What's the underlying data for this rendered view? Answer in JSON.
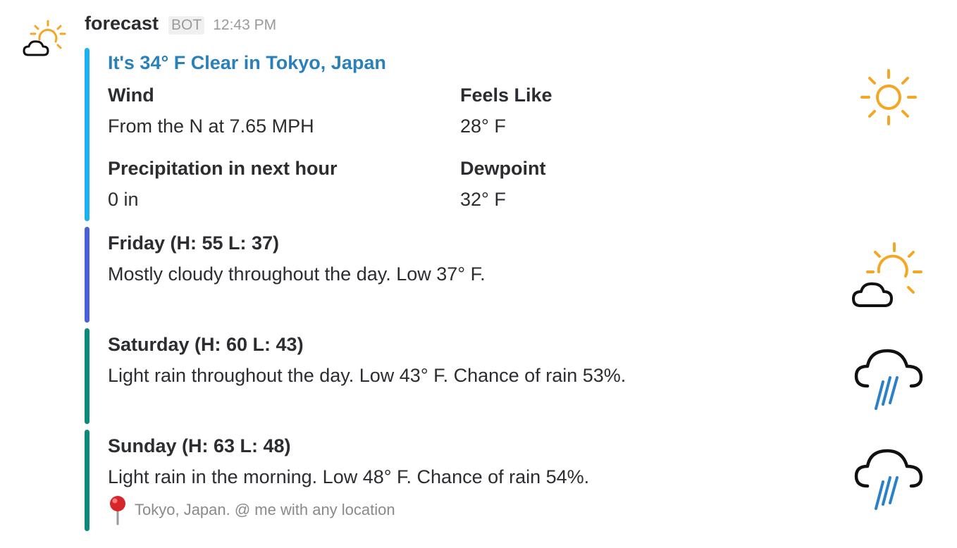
{
  "message": {
    "bot_name": "forecast",
    "badge": "BOT",
    "timestamp": "12:43 PM",
    "avatar_icon": "partly-cloudy-icon"
  },
  "current": {
    "title": "It's 34° F Clear in Tokyo, Japan",
    "bar_color": "#1ab3f0",
    "icon": "sun-icon",
    "fields": [
      {
        "title": "Wind",
        "value": "From the N at 7.65 MPH"
      },
      {
        "title": "Feels Like",
        "value": "28° F"
      },
      {
        "title": "Precipitation in next hour",
        "value": "0 in"
      },
      {
        "title": "Dewpoint",
        "value": "32° F"
      }
    ]
  },
  "forecast": [
    {
      "title": "Friday (H: 55 L: 37)",
      "text": "Mostly cloudy throughout the day. Low 37° F.",
      "bar_color": "#4a60d8",
      "icon": "partly-cloudy-icon"
    },
    {
      "title": "Saturday (H: 60 L: 43)",
      "text": "Light rain throughout the day. Low 43° F. Chance of rain 53%.",
      "bar_color": "#0a8a7a",
      "icon": "rain-cloud-icon"
    },
    {
      "title": "Sunday (H: 63 L: 48)",
      "text": "Light rain in the morning. Low 48° F. Chance of rain 54%.",
      "bar_color": "#0a8a7a",
      "icon": "rain-cloud-icon"
    }
  ],
  "footer": {
    "icon": "pushpin-icon",
    "text": "Tokyo, Japan. @ me with any location"
  },
  "colors": {
    "sun": "#f5a623",
    "rain": "#2a80c9",
    "link": "#2a80b9"
  }
}
